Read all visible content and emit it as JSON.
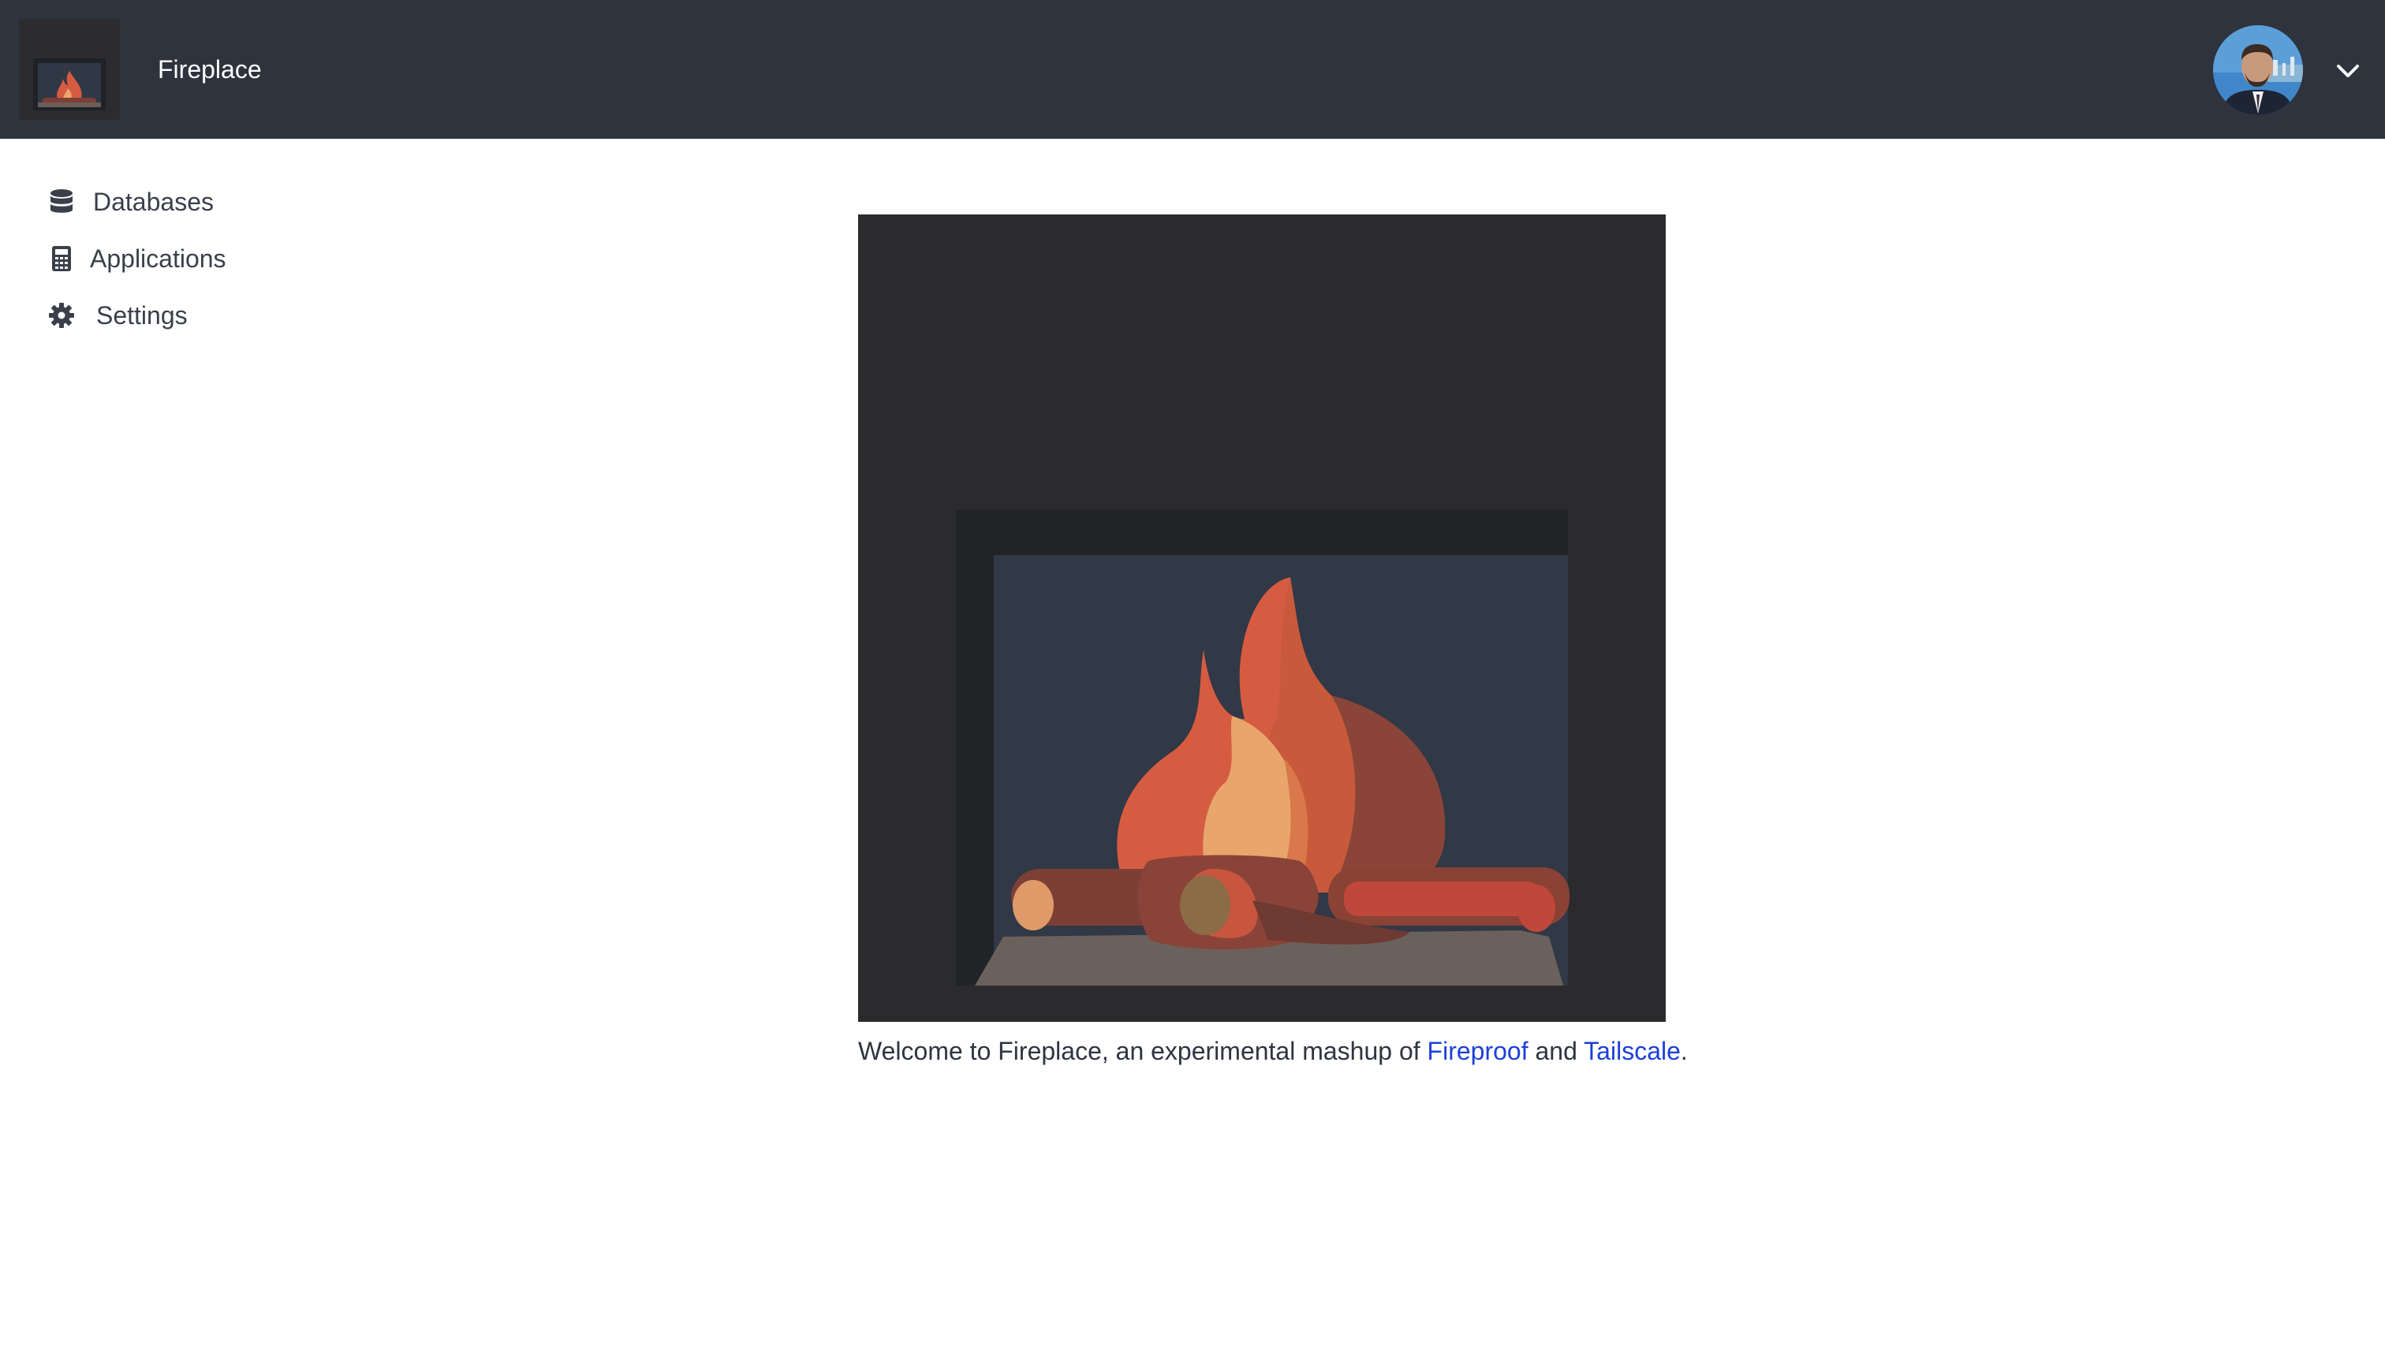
{
  "header": {
    "app_title": "Fireplace",
    "logo_icon": "fireplace-logo-icon",
    "avatar_icon": "user-avatar",
    "menu_icon": "chevron-down-icon"
  },
  "sidebar": {
    "items": [
      {
        "label": "Databases",
        "icon": "database-icon"
      },
      {
        "label": "Applications",
        "icon": "calculator-icon"
      },
      {
        "label": "Settings",
        "icon": "gear-icon"
      }
    ]
  },
  "main": {
    "hero_image": "fireplace-illustration",
    "welcome_prefix": "Welcome to Fireplace, an experimental mashup of ",
    "link1": "Fireproof",
    "between": " and ",
    "link2": "Tailscale",
    "suffix": "."
  },
  "colors": {
    "header_bg": "#2e333e",
    "link": "#1d3fd8",
    "text": "#2f3440"
  }
}
